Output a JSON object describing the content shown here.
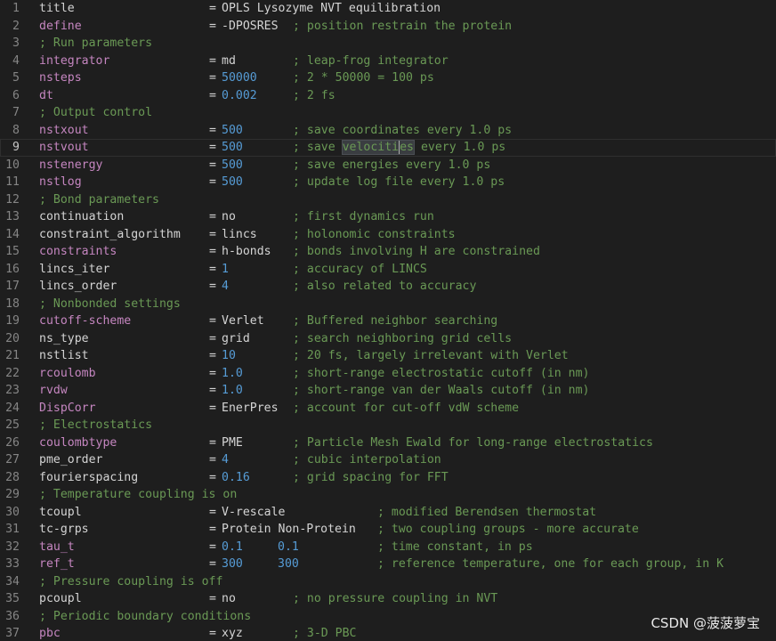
{
  "watermark": "CSDN @菠菠萝宝",
  "current_line": 9,
  "lines": [
    {
      "n": "1",
      "kind": "kv",
      "key": "title",
      "keyType": "var",
      "eq": "=",
      "v1": "OPLS Lysozyme NVT equilibration",
      "v1Type": "str"
    },
    {
      "n": "2",
      "kind": "kv",
      "key": "define",
      "keyType": "kw",
      "eq": "=",
      "v1": "-DPOSRES",
      "v1Type": "str",
      "comment": "; position restrain the protein",
      "ccol": "c1"
    },
    {
      "n": "3",
      "kind": "comment",
      "comment": "; Run parameters"
    },
    {
      "n": "4",
      "kind": "kv",
      "key": "integrator",
      "keyType": "kw",
      "eq": "=",
      "v1": "md",
      "v1Type": "str",
      "comment": "; leap-frog integrator",
      "ccol": "c1"
    },
    {
      "n": "5",
      "kind": "kv",
      "key": "nsteps",
      "keyType": "kw",
      "eq": "=",
      "v1": "50000",
      "v1Type": "num",
      "comment": "; 2 * 50000 = 100 ps",
      "ccol": "c1"
    },
    {
      "n": "6",
      "kind": "kv",
      "key": "dt",
      "keyType": "kw",
      "eq": "=",
      "v1": "0.002",
      "v1Type": "num",
      "comment": "; 2 fs",
      "ccol": "c1"
    },
    {
      "n": "7",
      "kind": "comment",
      "comment": "; Output control"
    },
    {
      "n": "8",
      "kind": "kv",
      "key": "nstxout",
      "keyType": "kw",
      "eq": "=",
      "v1": "500",
      "v1Type": "num",
      "comment": "; save coordinates every 1.0 ps",
      "ccol": "c1"
    },
    {
      "n": "9",
      "kind": "kv",
      "key": "nstvout",
      "keyType": "kw",
      "eq": "=",
      "v1": "500",
      "v1Type": "num",
      "comment": "; save ",
      "hl": "velociti",
      "hl2": "es",
      "commentTail": " every 1.0 ps",
      "ccol": "c1"
    },
    {
      "n": "10",
      "kind": "kv",
      "key": "nstenergy",
      "keyType": "kw",
      "eq": "=",
      "v1": "500",
      "v1Type": "num",
      "comment": "; save energies every 1.0 ps",
      "ccol": "c1"
    },
    {
      "n": "11",
      "kind": "kv",
      "key": "nstlog",
      "keyType": "kw",
      "eq": "=",
      "v1": "500",
      "v1Type": "num",
      "comment": "; update log file every 1.0 ps",
      "ccol": "c1"
    },
    {
      "n": "12",
      "kind": "comment",
      "comment": "; Bond parameters"
    },
    {
      "n": "13",
      "kind": "kv",
      "key": "continuation",
      "keyType": "var",
      "eq": "=",
      "v1": "no",
      "v1Type": "str",
      "comment": "; first dynamics run",
      "ccol": "c1"
    },
    {
      "n": "14",
      "kind": "kv",
      "key": "constraint_algorithm",
      "keyType": "var",
      "eq": "=",
      "v1": "lincs",
      "v1Type": "str",
      "comment": "; holonomic constraints",
      "ccol": "c1"
    },
    {
      "n": "15",
      "kind": "kv",
      "key": "constraints",
      "keyType": "kw",
      "eq": "=",
      "v1": "h-bonds",
      "v1Type": "str",
      "comment": "; bonds involving H are constrained",
      "ccol": "c1"
    },
    {
      "n": "16",
      "kind": "kv",
      "key": "lincs_iter",
      "keyType": "var",
      "eq": "=",
      "v1": "1",
      "v1Type": "num",
      "comment": "; accuracy of LINCS",
      "ccol": "c1"
    },
    {
      "n": "17",
      "kind": "kv",
      "key": "lincs_order",
      "keyType": "var",
      "eq": "=",
      "v1": "4",
      "v1Type": "num",
      "comment": "; also related to accuracy",
      "ccol": "c1"
    },
    {
      "n": "18",
      "kind": "comment",
      "comment": "; Nonbonded settings"
    },
    {
      "n": "19",
      "kind": "kv",
      "key": "cutoff-scheme",
      "keyType": "kw",
      "eq": "=",
      "v1": "Verlet",
      "v1Type": "str",
      "comment": "; Buffered neighbor searching",
      "ccol": "c1"
    },
    {
      "n": "20",
      "kind": "kv",
      "key": "ns_type",
      "keyType": "var",
      "eq": "=",
      "v1": "grid",
      "v1Type": "str",
      "comment": "; search neighboring grid cells",
      "ccol": "c1"
    },
    {
      "n": "21",
      "kind": "kv",
      "key": "nstlist",
      "keyType": "var",
      "eq": "=",
      "v1": "10",
      "v1Type": "num",
      "comment": "; 20 fs, largely irrelevant with Verlet",
      "ccol": "c1"
    },
    {
      "n": "22",
      "kind": "kv",
      "key": "rcoulomb",
      "keyType": "kw",
      "eq": "=",
      "v1": "1.0",
      "v1Type": "num",
      "comment": "; short-range electrostatic cutoff (in nm)",
      "ccol": "c1"
    },
    {
      "n": "23",
      "kind": "kv",
      "key": "rvdw",
      "keyType": "kw",
      "eq": "=",
      "v1": "1.0",
      "v1Type": "num",
      "comment": "; short-range van der Waals cutoff (in nm)",
      "ccol": "c1"
    },
    {
      "n": "24",
      "kind": "kv",
      "key": "DispCorr",
      "keyType": "kw",
      "eq": "=",
      "v1": "EnerPres",
      "v1Type": "str",
      "comment": "; account for cut-off vdW scheme",
      "ccol": "c1"
    },
    {
      "n": "25",
      "kind": "comment",
      "comment": "; Electrostatics"
    },
    {
      "n": "26",
      "kind": "kv",
      "key": "coulombtype",
      "keyType": "kw",
      "eq": "=",
      "v1": "PME",
      "v1Type": "str",
      "comment": "; Particle Mesh Ewald for long-range electrostatics",
      "ccol": "c1"
    },
    {
      "n": "27",
      "kind": "kv",
      "key": "pme_order",
      "keyType": "var",
      "eq": "=",
      "v1": "4",
      "v1Type": "num",
      "comment": "; cubic interpolation",
      "ccol": "c1"
    },
    {
      "n": "28",
      "kind": "kv",
      "key": "fourierspacing",
      "keyType": "var",
      "eq": "=",
      "v1": "0.16",
      "v1Type": "num",
      "comment": "; grid spacing for FFT",
      "ccol": "c1"
    },
    {
      "n": "29",
      "kind": "comment",
      "comment": "; Temperature coupling is on"
    },
    {
      "n": "30",
      "kind": "kv",
      "key": "tcoupl",
      "keyType": "var",
      "eq": "=",
      "v1": "V-rescale",
      "v1Type": "str",
      "comment": "; modified Berendsen thermostat",
      "ccol": "c2"
    },
    {
      "n": "31",
      "kind": "kv",
      "key": "tc-grps",
      "keyType": "var",
      "eq": "=",
      "v1": "Protein Non-Protein",
      "v1Type": "str",
      "comment": "; two coupling groups - more accurate",
      "ccol": "c2"
    },
    {
      "n": "32",
      "kind": "kv",
      "key": "tau_t",
      "keyType": "kw",
      "eq": "=",
      "v1": "0.1",
      "v1Type": "num",
      "v2": "0.1",
      "comment": "; time constant, in ps",
      "ccol": "c2"
    },
    {
      "n": "33",
      "kind": "kv",
      "key": "ref_t",
      "keyType": "kw",
      "eq": "=",
      "v1": "300",
      "v1Type": "num",
      "v2": "300",
      "comment": "; reference temperature, one for each group, in K",
      "ccol": "c2"
    },
    {
      "n": "34",
      "kind": "comment",
      "comment": "; Pressure coupling is off"
    },
    {
      "n": "35",
      "kind": "kv",
      "key": "pcoupl",
      "keyType": "var",
      "eq": "=",
      "v1": "no",
      "v1Type": "str",
      "comment": "; no pressure coupling in NVT",
      "ccol": "c1"
    },
    {
      "n": "36",
      "kind": "comment",
      "comment": "; Periodic boundary conditions"
    },
    {
      "n": "37",
      "kind": "kv",
      "key": "pbc",
      "keyType": "kw",
      "eq": "=",
      "v1": "xyz",
      "v1Type": "str",
      "comment": "; 3-D PBC",
      "ccol": "c1"
    }
  ]
}
